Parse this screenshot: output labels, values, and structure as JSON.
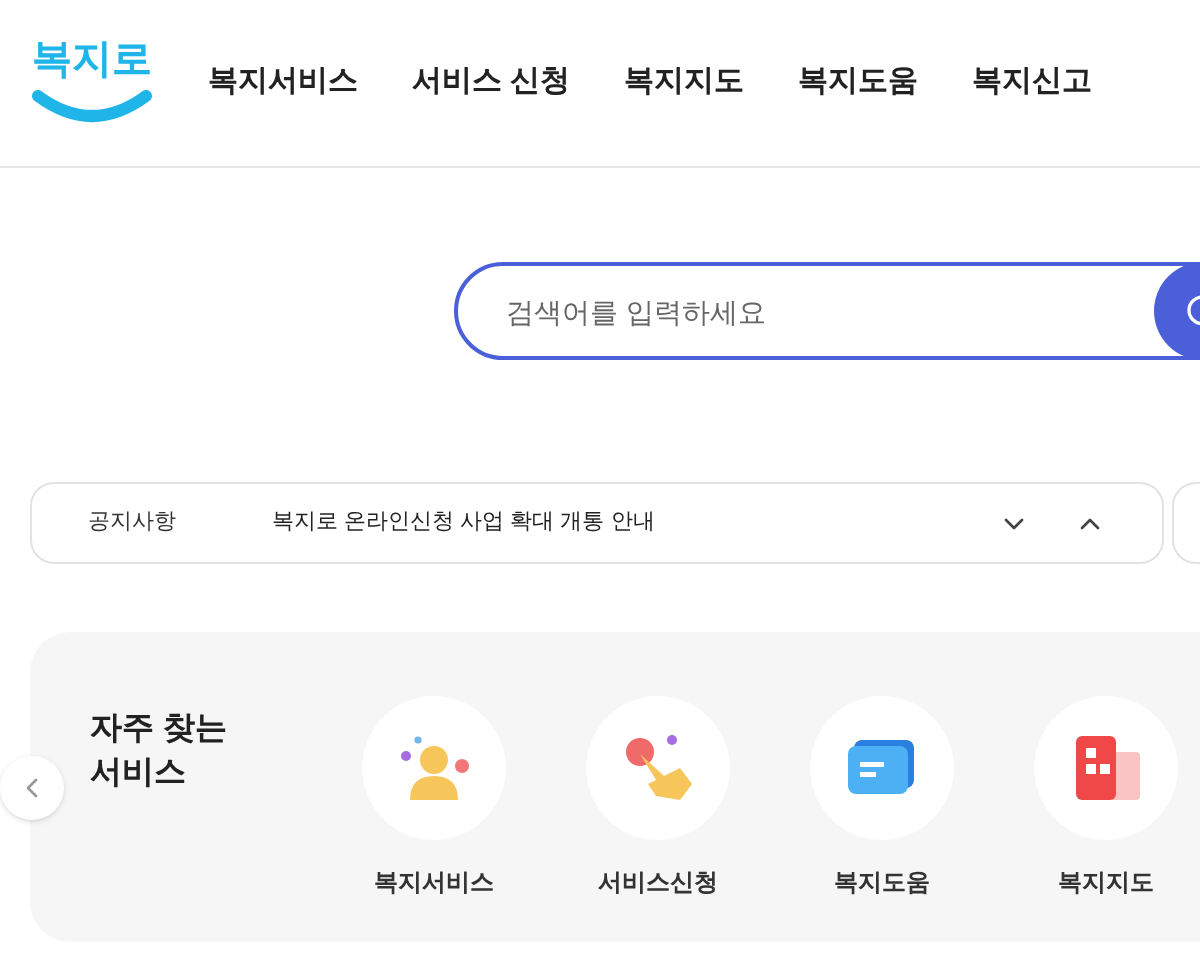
{
  "logo": {
    "text": "복지로"
  },
  "nav": [
    {
      "label": "복지서비스"
    },
    {
      "label": "서비스 신청"
    },
    {
      "label": "복지지도"
    },
    {
      "label": "복지도움"
    },
    {
      "label": "복지신고"
    }
  ],
  "search": {
    "placeholder": "검색어를 입력하세요"
  },
  "notice": {
    "label": "공지사항",
    "text": "복지로 온라인신청 사업 확대 개통 안내"
  },
  "services": {
    "title": "자주 찾는\n서비스",
    "items": [
      {
        "kind": "person",
        "label": "복지서비스"
      },
      {
        "kind": "hand",
        "label": "서비스신청"
      },
      {
        "kind": "chat",
        "label": "복지도움"
      },
      {
        "kind": "building",
        "label": "복지지도"
      }
    ]
  }
}
